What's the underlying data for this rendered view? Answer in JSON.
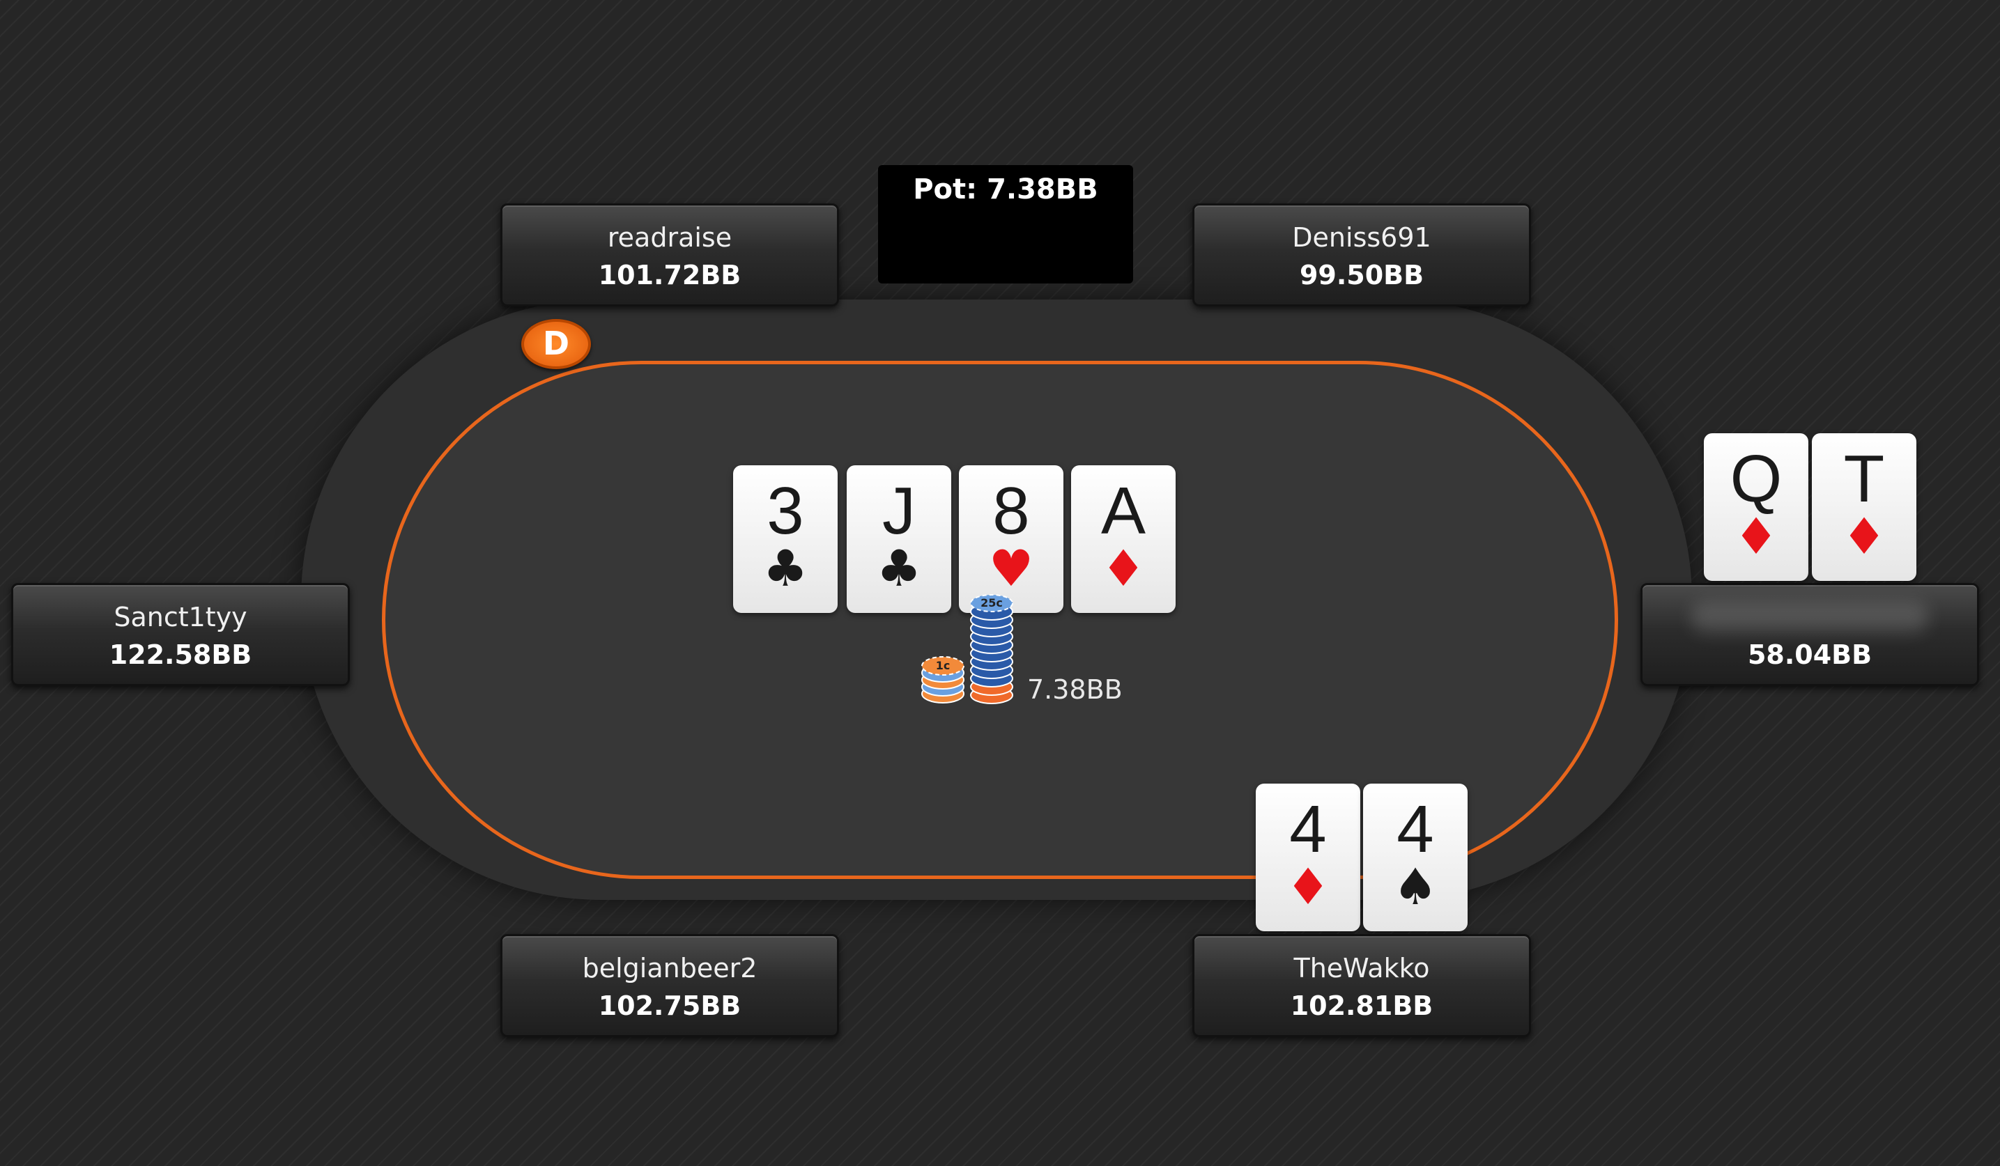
{
  "table": {
    "pot_label": "Pot: 7.38BB",
    "dealer_label": "D",
    "bet_amount": "7.38BB",
    "chip_labels": [
      "25c",
      "1c"
    ],
    "board": [
      {
        "rank": "3",
        "suit": "♣",
        "color": "black"
      },
      {
        "rank": "J",
        "suit": "♣",
        "color": "black"
      },
      {
        "rank": "8",
        "suit": "♥",
        "color": "red"
      },
      {
        "rank": "A",
        "suit": "♦",
        "color": "red"
      }
    ]
  },
  "seats": [
    {
      "name": "readraise",
      "stack": "101.72BB"
    },
    {
      "name": "Deniss691",
      "stack": "99.50BB"
    },
    {
      "name": "Sanct1tyy",
      "stack": "122.58BB"
    },
    {
      "name": "",
      "stack": "58.04BB",
      "hole_cards": [
        {
          "rank": "Q",
          "suit": "♦"
        },
        {
          "rank": "T",
          "suit": "♦"
        }
      ]
    },
    {
      "name": "belgianbeer2",
      "stack": "102.75BB"
    },
    {
      "name": "TheWakko",
      "stack": "102.81BB",
      "hole_cards": [
        {
          "rank": "4",
          "suit": "♦"
        },
        {
          "rank": "4",
          "suit": "♠"
        }
      ]
    }
  ],
  "colors": {
    "felt_rail": "#e8661c",
    "dealer": "#f07a20",
    "red_suit": "#e8141a"
  }
}
